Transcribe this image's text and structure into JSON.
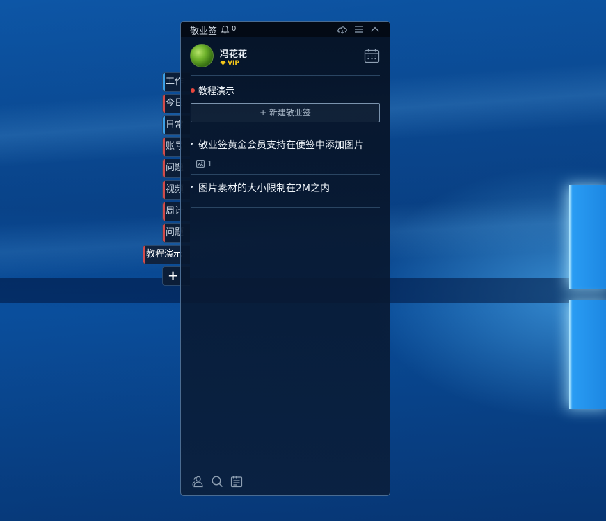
{
  "colors": {
    "panel_bg": "#061224",
    "accent_red": "#e8473d",
    "vip_gold": "#f2c51b",
    "text_light": "#eef3f8",
    "border": "#4a6c92"
  },
  "side_tabs": [
    {
      "label": "工作",
      "stripe": "#3aa0e8",
      "active": false
    },
    {
      "label": "今日",
      "stripe": "#d24b4b",
      "active": false
    },
    {
      "label": "日常",
      "stripe": "#3aa0e8",
      "active": false
    },
    {
      "label": "账号",
      "stripe": "#d24b4b",
      "active": false
    },
    {
      "label": "问题",
      "stripe": "#d24b4b",
      "active": false
    },
    {
      "label": "视频",
      "stripe": "#d24b4b",
      "active": false
    },
    {
      "label": "周计",
      "stripe": "#d24b4b",
      "active": false
    },
    {
      "label": "问题",
      "stripe": "#d24b4b",
      "active": false
    },
    {
      "label": "教程演示",
      "stripe": "#d24b4b",
      "active": true
    }
  ],
  "add_tab_label": "+",
  "titlebar": {
    "app_name": "敬业签",
    "notification_count": "0",
    "icons": [
      "cloud-icon",
      "menu-icon",
      "collapse-icon"
    ]
  },
  "user": {
    "name": "冯花花",
    "badge": "VIP"
  },
  "category": {
    "name": "教程演示"
  },
  "new_note_button": "+ 新建敬业签",
  "notes": [
    {
      "text": "敬业签黄金会员支持在便签中添加图片",
      "image_count": "1"
    },
    {
      "text": "图片素材的大小限制在2M之内",
      "image_count": ""
    }
  ],
  "footer_icons": [
    "contacts-icon",
    "search-icon",
    "notes-list-icon"
  ]
}
